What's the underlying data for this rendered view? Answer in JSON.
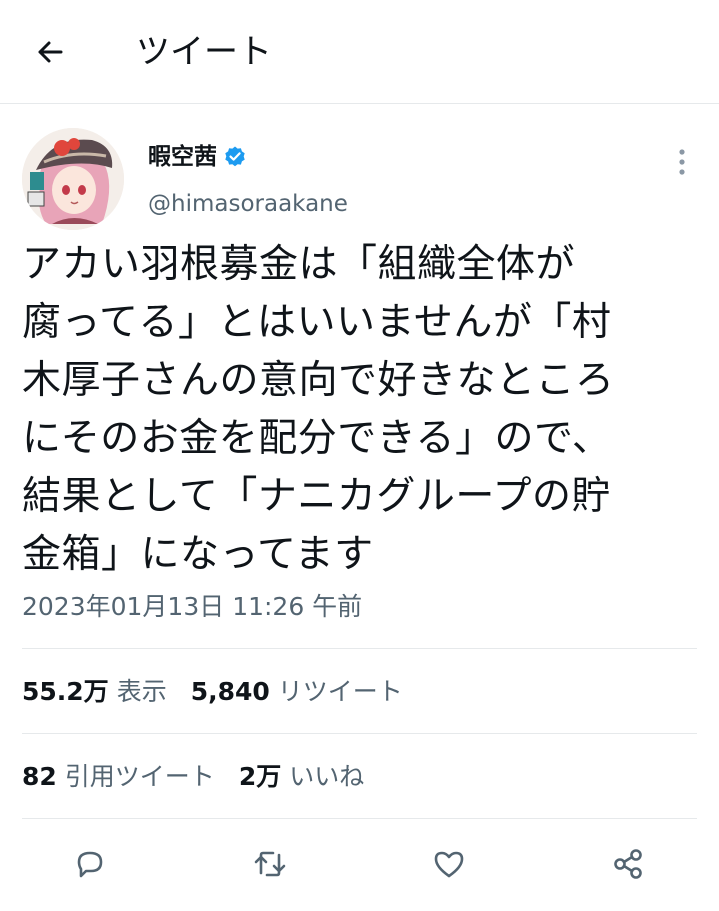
{
  "header": {
    "title": "ツイート",
    "back_icon": "arrow-left-icon"
  },
  "user": {
    "name": "暇空茜",
    "handle": "@himasoraakane",
    "verified": true,
    "verified_color": "#1d9bf0"
  },
  "tweet": {
    "text": "アカい羽根募金は「組織全体が\n腐ってる」とはいいませんが「村\n木厚子さんの意向で好きなところ\nにそのお金を配分できる」ので、\n結果として「ナニカグループの貯\n金箱」になってます",
    "timestamp": "2023年01月13日 11:26 午前"
  },
  "stats": {
    "views_count": "55.2万",
    "views_label": "表示",
    "retweets_count": "5,840",
    "retweets_label": "リツイート",
    "quotes_count": "82",
    "quotes_label": "引用ツイート",
    "likes_count": "2万",
    "likes_label": "いいね"
  },
  "actions": {
    "reply_icon": "reply-icon",
    "retweet_icon": "retweet-icon",
    "like_icon": "heart-icon",
    "share_icon": "share-icon"
  },
  "colors": {
    "text_primary": "#0f1419",
    "text_secondary": "#536471",
    "divider": "#e6e9eb"
  }
}
